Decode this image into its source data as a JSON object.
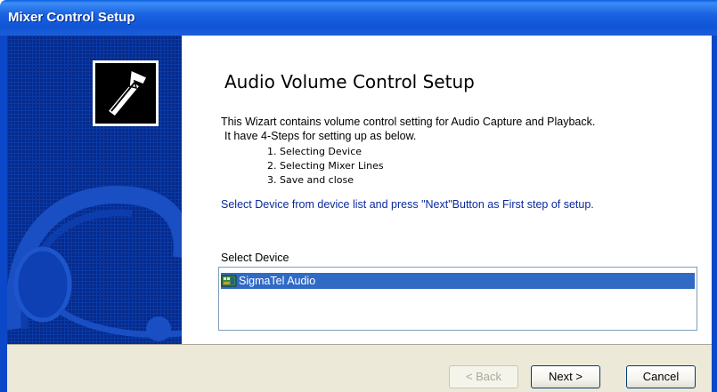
{
  "window": {
    "title": "Mixer Control Setup"
  },
  "sidebar": {
    "logo_icon": "pipe-wrench-icon",
    "background_icon": "headset-icon"
  },
  "main": {
    "heading": "Audio Volume Control Setup",
    "description_line1": "This Wizart contains volume control setting for Audio Capture and Playback.",
    "description_line2": "It have 4-Steps for setting up as below.",
    "steps": [
      "1. Selecting Device",
      "2. Selecting Mixer Lines",
      "3. Save and close"
    ],
    "instruction": "Select Device from device list and press \"Next\"Button as First step of setup.",
    "device_list": {
      "label": "Select Device",
      "items": [
        {
          "name": "SigmaTel Audio",
          "selected": true,
          "icon": "audio-device-icon"
        }
      ]
    }
  },
  "buttons": {
    "back": "< Back",
    "next": "Next >",
    "cancel": "Cancel"
  },
  "colors": {
    "title_bar": "#1a63e2",
    "sidebar": "#052a8a",
    "selection": "#316ac5",
    "instruction_text": "#0a2a9a",
    "footer": "#ece9d8"
  }
}
